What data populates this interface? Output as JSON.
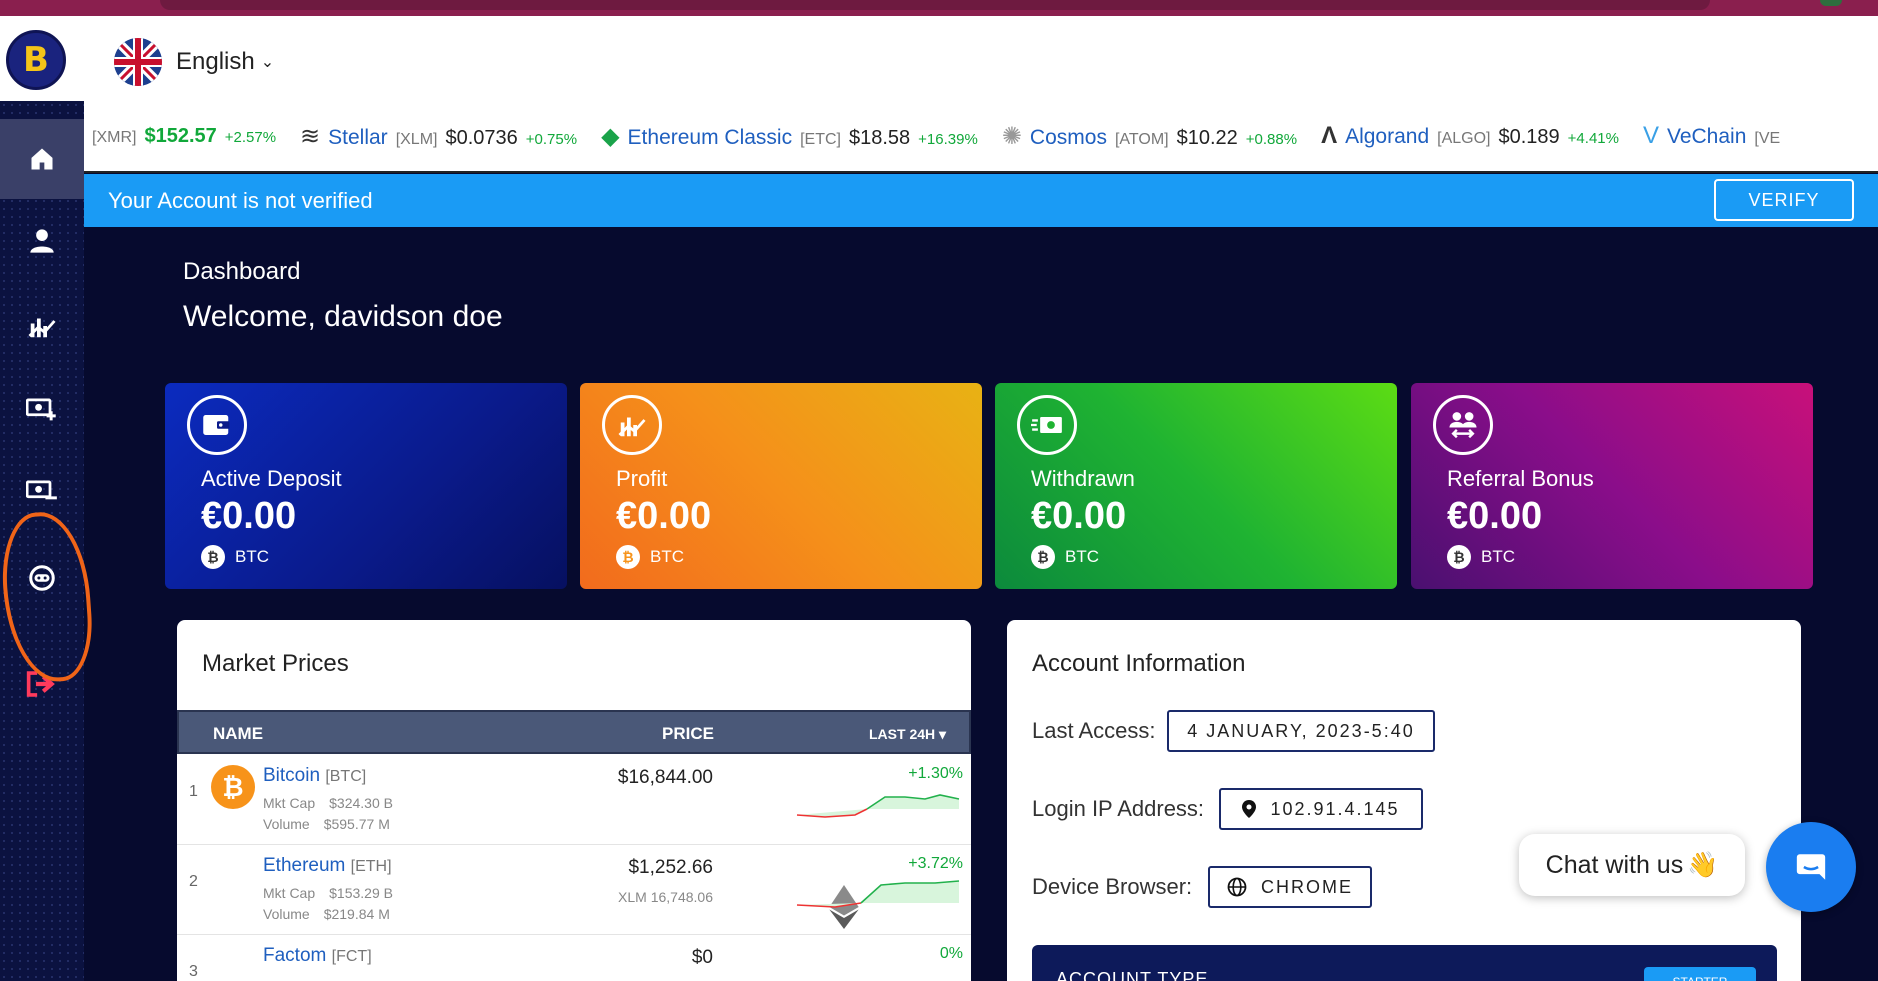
{
  "header": {
    "logo_letter": "B",
    "language": "English"
  },
  "sidebar": {
    "items": [
      {
        "name": "home",
        "icon": "home-icon"
      },
      {
        "name": "profile",
        "icon": "user-icon"
      },
      {
        "name": "investments",
        "icon": "chart-icon"
      },
      {
        "name": "deposit",
        "icon": "money-add-icon"
      },
      {
        "name": "withdraw",
        "icon": "money-minus-icon"
      },
      {
        "name": "support",
        "icon": "support-icon"
      },
      {
        "name": "logout",
        "icon": "logout-icon"
      }
    ]
  },
  "ticker": [
    {
      "name": "",
      "symbol": "[XMR]",
      "price": "$152.57",
      "change": "+2.57%",
      "icon": ""
    },
    {
      "name": "Stellar",
      "symbol": "[XLM]",
      "price": "$0.0736",
      "change": "+0.75%",
      "icon": "stellar-icon"
    },
    {
      "name": "Ethereum Classic",
      "symbol": "[ETC]",
      "price": "$18.58",
      "change": "+16.39%",
      "icon": "etc-icon"
    },
    {
      "name": "Cosmos",
      "symbol": "[ATOM]",
      "price": "$10.22",
      "change": "+0.88%",
      "icon": "cosmos-icon"
    },
    {
      "name": "Algorand",
      "symbol": "[ALGO]",
      "price": "$0.189",
      "change": "+4.41%",
      "icon": "algorand-icon"
    },
    {
      "name": "VeChain",
      "symbol": "[VE",
      "price": "",
      "change": "",
      "icon": "vechain-icon"
    }
  ],
  "banner": {
    "text": "Your Account is not verified",
    "verify": "VERIFY"
  },
  "dashboard": {
    "label": "Dashboard",
    "welcome": "Welcome, davidson doe"
  },
  "cards": [
    {
      "title": "Active Deposit",
      "value": "€0.00",
      "currency": "BTC"
    },
    {
      "title": "Profit",
      "value": "€0.00",
      "currency": "BTC"
    },
    {
      "title": "Withdrawn",
      "value": "€0.00",
      "currency": "BTC"
    },
    {
      "title": "Referral Bonus",
      "value": "€0.00",
      "currency": "BTC"
    }
  ],
  "market": {
    "title": "Market Prices",
    "headers": {
      "name": "NAME",
      "price": "PRICE",
      "change": "LAST 24H"
    },
    "rows": [
      {
        "index": "1",
        "name": "Bitcoin",
        "symbol": "[BTC]",
        "mktcap_label": "Mkt Cap",
        "mktcap": "$324.30 B",
        "volume_label": "Volume",
        "volume": "$595.77 M",
        "price": "$16,844.00",
        "sub": "",
        "change": "+1.30%",
        "coin_color": "#f7931a",
        "coin_letter": "₿"
      },
      {
        "index": "2",
        "name": "Ethereum",
        "symbol": "[ETH]",
        "mktcap_label": "Mkt Cap",
        "mktcap": "$153.29 B",
        "volume_label": "Volume",
        "volume": "$219.84 M",
        "price": "$1,252.66",
        "sub": "XLM 16,748.06",
        "change": "+3.72%",
        "coin_color": "#ffffff",
        "coin_letter": "◆"
      },
      {
        "index": "3",
        "name": "Factom",
        "symbol": "[FCT]",
        "mktcap_label": "",
        "mktcap": "",
        "volume_label": "",
        "volume": "",
        "price": "$0",
        "sub": "",
        "change": "0%",
        "coin_color": "#ffffff",
        "coin_letter": ""
      }
    ]
  },
  "account": {
    "title": "Account Information",
    "last_access_label": "Last Access:",
    "last_access": "4 JANUARY, 2023-5:40",
    "ip_label": "Login IP Address:",
    "ip": "102.91.4.145",
    "browser_label": "Device Browser:",
    "browser": "CHROME",
    "type_label": "ACCOUNT TYPE",
    "type_badge": "STARTER"
  },
  "chat": {
    "label": "Chat with us",
    "emoji": "👋"
  }
}
